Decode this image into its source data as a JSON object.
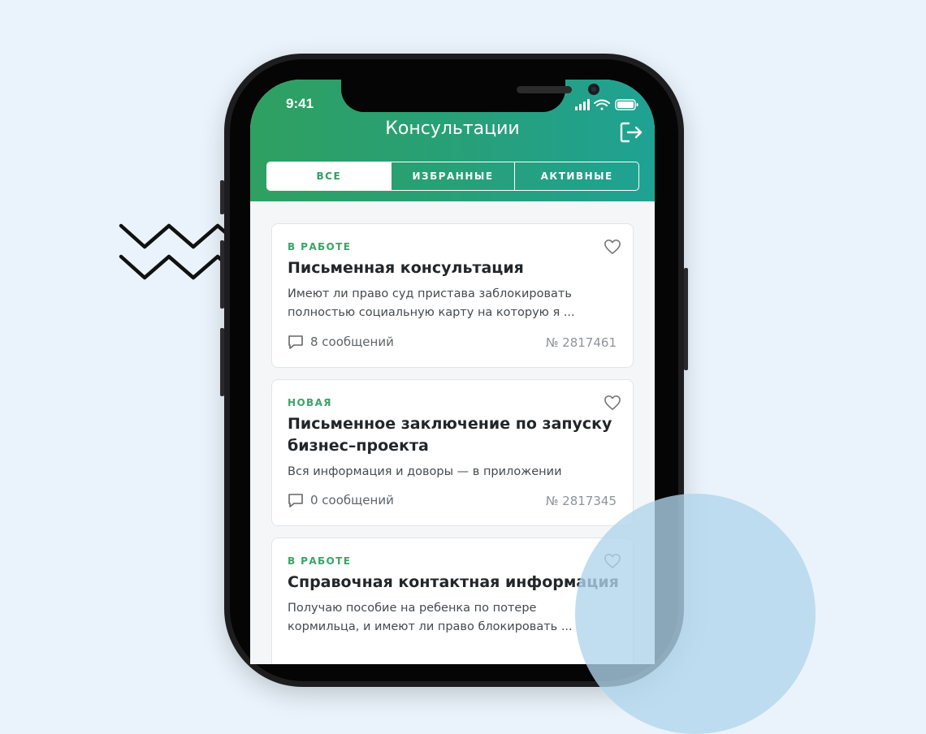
{
  "status_bar": {
    "time": "9:41"
  },
  "header": {
    "title": "Консультации",
    "tabs": [
      {
        "label": "ВСЕ",
        "active": true
      },
      {
        "label": "ИЗБРАННЫЕ",
        "active": false
      },
      {
        "label": "АКТИВНЫЕ",
        "active": false
      }
    ]
  },
  "cards": [
    {
      "status": "В РАБОТЕ",
      "title": "Письменная консультация",
      "description": "Имеют ли право суд пристава заблокировать полностью социальную карту на которую я ...",
      "messages": "8 сообщений",
      "number": "№ 2817461"
    },
    {
      "status": "НОВАЯ",
      "title": "Письменное заключение по запуску бизнес–проекта",
      "description": "Вся информация и доворы — в приложении",
      "messages": "0 сообщений",
      "number": "№ 2817345"
    },
    {
      "status": "В РАБОТЕ",
      "title": "Справочная контактная информация",
      "description": "Получаю пособие на ребенка по потере кормильца, и имеют ли право блокировать ...",
      "messages": "",
      "number": ""
    }
  ],
  "colors": {
    "accent_green": "#2f9e62",
    "header_gradient_start": "#2fa061",
    "header_gradient_end": "#1fa294",
    "background": "#eaf3fb"
  },
  "icons": [
    "logout-icon",
    "heart-icon",
    "chat-icon",
    "signal-icon",
    "wifi-icon",
    "battery-icon"
  ]
}
